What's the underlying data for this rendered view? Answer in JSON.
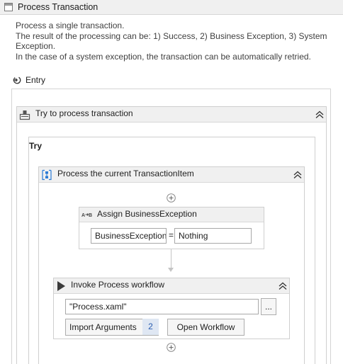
{
  "window": {
    "title": "Process Transaction"
  },
  "description": {
    "lines": [
      "Process a single transaction.",
      "The result of the processing can be: 1) Success, 2) Business Exception, 3) System",
      "Exception.",
      "In the case of a system exception, the transaction can be automatically retried."
    ]
  },
  "entry": {
    "label": "Entry"
  },
  "try_catch": {
    "title": "Try to process transaction",
    "try_label": "Try"
  },
  "sequence": {
    "title": "Process the current TransactionItem"
  },
  "assign": {
    "title": "Assign BusinessException",
    "to_value": "BusinessException",
    "operator": "=",
    "value": "Nothing"
  },
  "invoke": {
    "title": "Invoke Process workflow",
    "file_value": "\"Process.xaml\"",
    "browse_label": "...",
    "import_label": "Import Arguments",
    "import_count": "2",
    "open_label": "Open Workflow"
  },
  "colors": {
    "header_bg": "#f0f0f0",
    "border": "#cfcfcf",
    "badge_text": "#2a5db0",
    "badge_bg": "#dfe7f3",
    "sequence_icon": "#2b7bd6"
  },
  "icons": {
    "title": "workflow-file-icon",
    "entry": "entry-flow-icon",
    "try_catch": "try-catch-icon",
    "sequence": "sequence-icon",
    "assign": "assign-icon",
    "invoke": "invoke-play-icon",
    "collapse": "double-chevron-up-icon",
    "add": "plus-circle-icon"
  }
}
